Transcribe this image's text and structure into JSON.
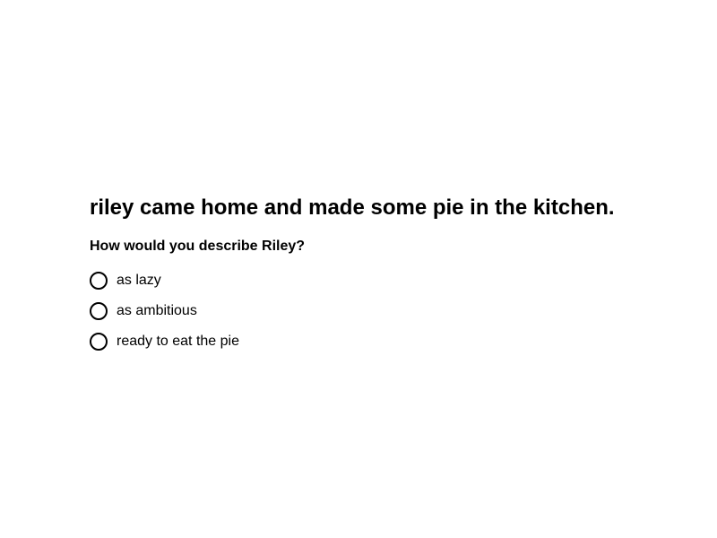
{
  "prompt": {
    "title": "riley came home and made some pie in the kitchen.",
    "question": "How would you describe Riley?"
  },
  "options": [
    {
      "label": "as lazy",
      "selected": false
    },
    {
      "label": "as ambitious",
      "selected": false
    },
    {
      "label": "ready to eat the pie",
      "selected": false
    }
  ],
  "colors": {
    "text": "#000000",
    "background": "#ffffff",
    "radio_border": "#000000"
  }
}
